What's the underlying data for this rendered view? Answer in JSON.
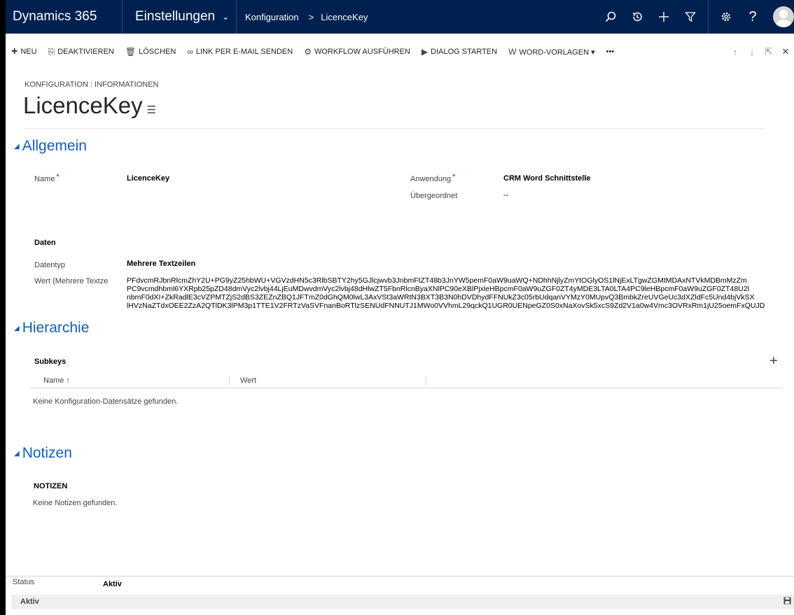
{
  "nav": {
    "brand": "Dynamics 365",
    "area": "Einstellungen",
    "crumbs": [
      "Konfiguration",
      "LicenceKey"
    ],
    "icons": [
      "search-icon",
      "history-icon",
      "plus-icon",
      "filter-icon",
      "gear-icon",
      "help-icon",
      "user-avatar"
    ]
  },
  "commands": [
    {
      "name": "new-button",
      "icon": "plus-icon",
      "glyph": "+",
      "label": "NEU"
    },
    {
      "name": "deactivate-button",
      "icon": "deactivate-icon",
      "glyph": "⎘",
      "label": "DEAKTIVIEREN"
    },
    {
      "name": "delete-button",
      "icon": "trash-icon",
      "glyph": "🗑",
      "label": "LÖSCHEN"
    },
    {
      "name": "email-link-button",
      "icon": "link-icon",
      "glyph": "∞",
      "label": "LINK PER E-MAIL SENDEN"
    },
    {
      "name": "run-workflow-button",
      "icon": "workflow-icon",
      "glyph": "⚙",
      "label": "WORKFLOW AUSFÜHREN"
    },
    {
      "name": "start-dialog-button",
      "icon": "dialog-icon",
      "glyph": "▶",
      "label": "DIALOG STARTEN"
    },
    {
      "name": "word-templates-button",
      "icon": "word-icon",
      "glyph": "W",
      "label": "WORD-VORLAGEN ▾"
    },
    {
      "name": "more-commands-button",
      "icon": "more-icon",
      "glyph": "",
      "label": "•••"
    }
  ],
  "header": {
    "entity_label": "KONFIGURATION : INFORMATIONEN",
    "title": "LicenceKey"
  },
  "sections": {
    "general": "Allgemein",
    "hierarchy": "Hierarchie",
    "notes": "Notizen"
  },
  "fields": {
    "name_label": "Name",
    "name_value": "LicenceKey",
    "app_label": "Anwendung",
    "app_value": "CRM Word Schnittstelle",
    "parent_label": "Übergeordnet",
    "parent_value": "--",
    "data_heading": "Daten",
    "datatype_label": "Datentyp",
    "datatype_value": "Mehrere Textzeilen",
    "value_label": "Wert (Mehrere Textze",
    "value_lines": [
      "PFdvcmRJbnRlcmZhY2U+PG9yZ25hbWU+VGVzdHN5c3RlbSBTY2hy5GJlcjwvb3JnbmFtZT48b3JnYW5pemF0aW9uaWQ+NDhhNjlyZmYtOGlyOS1lNjExLTgwZGMtMDAxNTVkMDBmMzZm",
      "PC9vcmdhbml6YXRpb25pZD48dmVyc2lvbj44LjEuMDwvdmVyc2lvbj48dHlwZT5FbnRlcnByaXNlPC90eXBlPjxleHBpcmF0aW9uZGF0ZT4yMDE3LTA0LTA4PC9leHBpcmF0aW9uZGF0ZT48U2l",
      "nbmF0dXI+ZkRadlE3cVZPMTZjS2dBS3ZEZnZBQ1JFTmZ0dGhQM0lwL3AxVSt3aWRtN3BXT3B3N0hDVDhydFFNUkZ3c05rbUdqanVYMzY0MUpvQ3BmbkZreUVGeUc3dXZldFc5Und4bjVkSX",
      "lHVzNaZTdxOEE2ZzA2QTlDK3lPM3p1TTE1V2FRTzVaSVFnanBoRTlzSENUdFNNUTJ1MWo0VVhmL29qckQ1UGR0UENpeGZ0S0xNaXovSk5xcS9Zd2V1a0w4Vmc3OVRxRm1jU25oemFxQUJD"
    ]
  },
  "subgrid": {
    "title": "Subkeys",
    "columns": [
      "Name ↑",
      "Wert"
    ],
    "empty": "Keine Konfiguration-Datensätze gefunden."
  },
  "notes": {
    "title": "NOTIZEN",
    "empty": "Keine Notizen gefunden."
  },
  "footer": {
    "status_label": "Status",
    "status_value": "Aktiv",
    "statusbar_text": "Aktiv"
  }
}
